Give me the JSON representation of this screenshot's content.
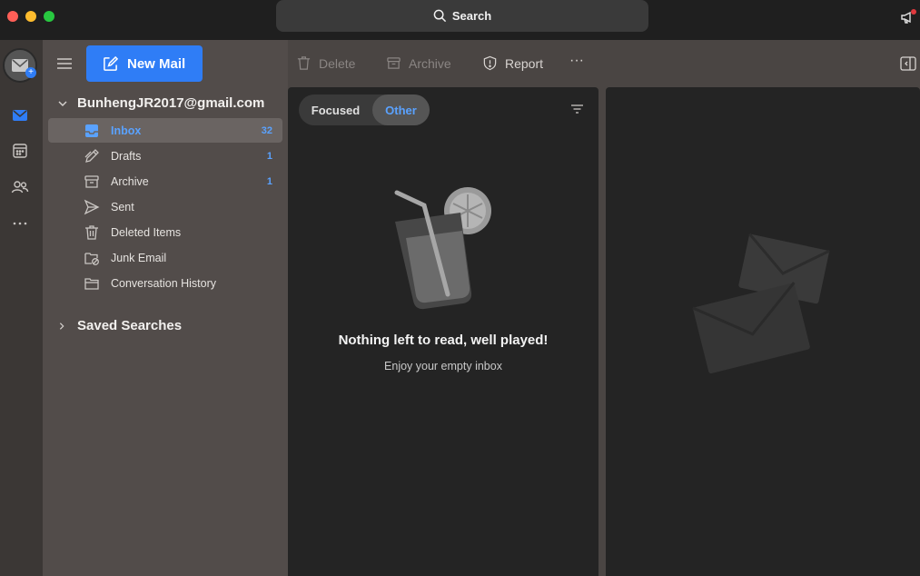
{
  "search": {
    "label": "Search"
  },
  "toolbar": {
    "new_mail": "New Mail",
    "delete": "Delete",
    "archive": "Archive",
    "report": "Report",
    "more": "···"
  },
  "account": {
    "email": "BunhengJR2017@gmail.com"
  },
  "folders": [
    {
      "name": "Inbox",
      "count": "32",
      "icon": "inbox-icon"
    },
    {
      "name": "Drafts",
      "count": "1",
      "icon": "pencil-icon"
    },
    {
      "name": "Archive",
      "count": "1",
      "icon": "archive-box-icon"
    },
    {
      "name": "Sent",
      "count": "",
      "icon": "send-icon"
    },
    {
      "name": "Deleted Items",
      "count": "",
      "icon": "trash-icon"
    },
    {
      "name": "Junk Email",
      "count": "",
      "icon": "junk-folder-icon"
    },
    {
      "name": "Conversation History",
      "count": "",
      "icon": "folder-icon"
    }
  ],
  "saved_searches": "Saved Searches",
  "pivot": {
    "focused": "Focused",
    "other": "Other",
    "selected": "Other"
  },
  "empty": {
    "title": "Nothing left to read, well played!",
    "subtitle": "Enjoy your empty inbox"
  },
  "colors": {
    "accent": "#2f7df6",
    "link": "#5aa2ff"
  }
}
